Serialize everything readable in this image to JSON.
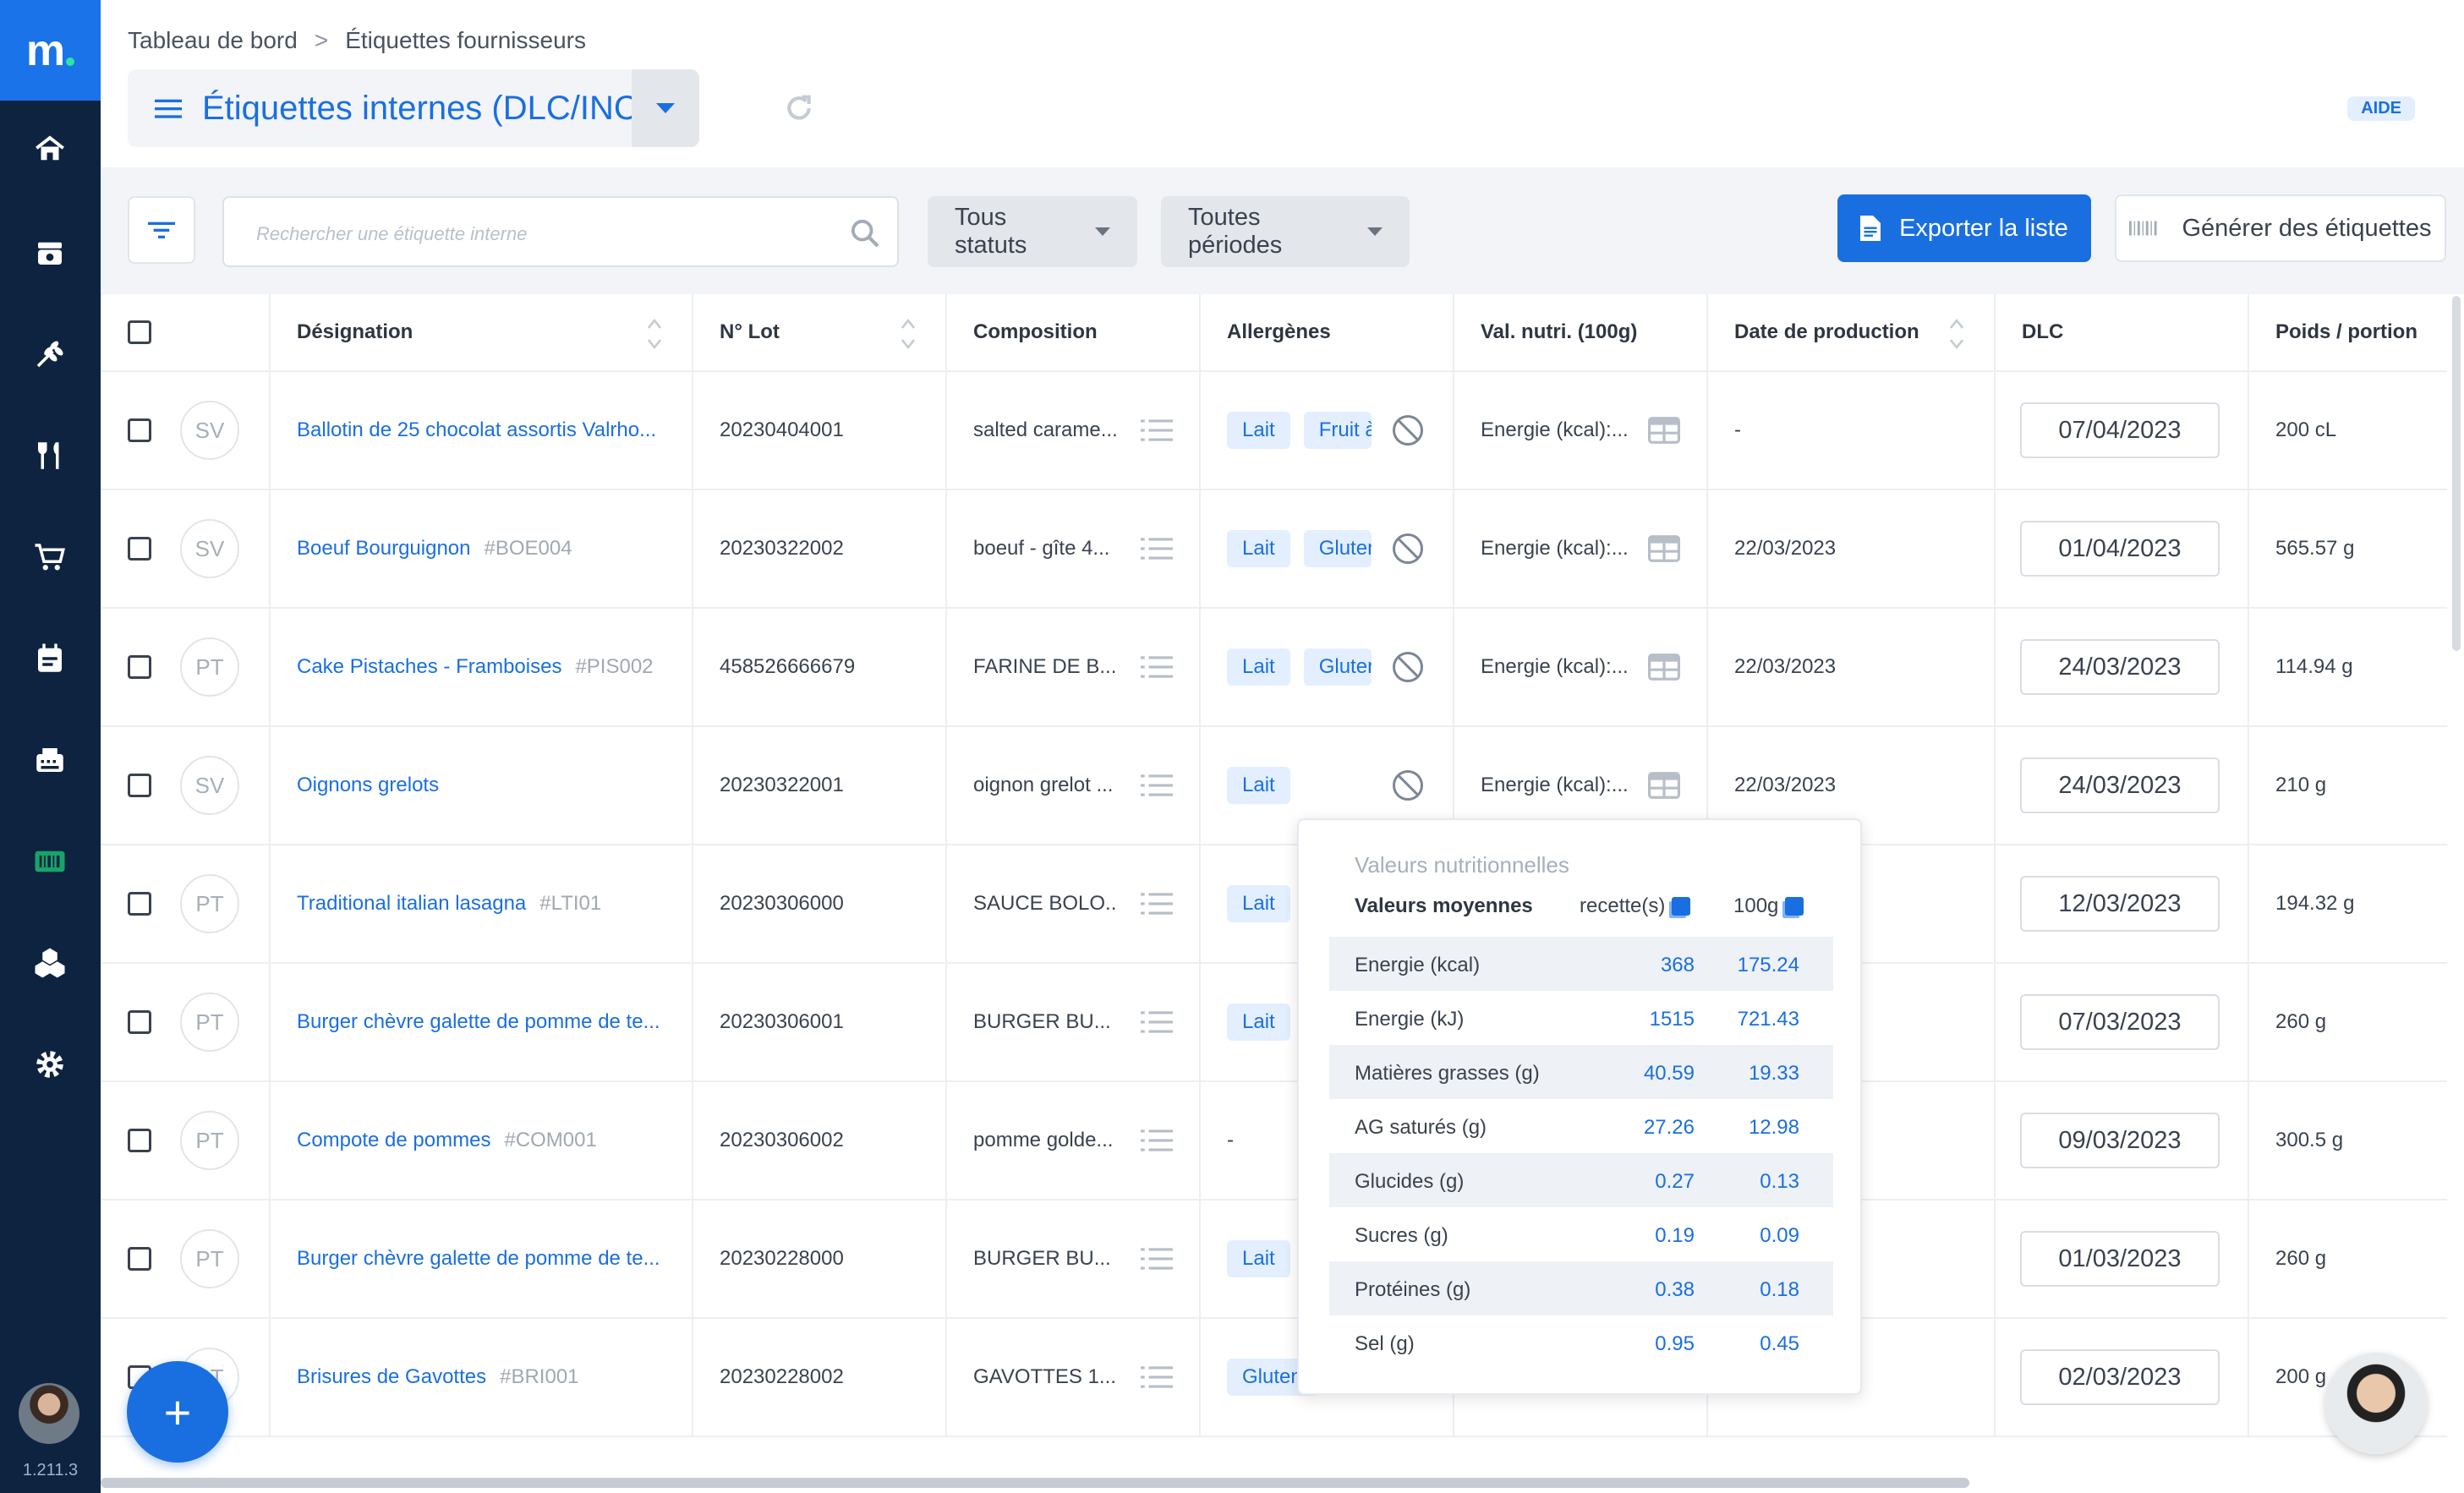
{
  "app": {
    "logo": "m",
    "version": "1.211.3"
  },
  "sidebar": {
    "items": [
      {
        "icon": "home-icon"
      },
      {
        "icon": "inbox-icon"
      },
      {
        "icon": "wheat-icon"
      },
      {
        "icon": "utensils-icon"
      },
      {
        "icon": "cart-icon"
      },
      {
        "icon": "calendar-icon"
      },
      {
        "icon": "printer-icon"
      },
      {
        "icon": "barcode-icon"
      },
      {
        "icon": "boxes-icon"
      },
      {
        "icon": "gear-icon"
      }
    ]
  },
  "breadcrumb": {
    "items": [
      "Tableau de bord",
      "Étiquettes fournisseurs"
    ],
    "separator": ">"
  },
  "header": {
    "title": "Étiquettes internes (DLC/INCO)",
    "help": "AIDE"
  },
  "toolbar": {
    "search_placeholder": "Rechercher une étiquette interne",
    "status_filter": "Tous statuts",
    "period_filter": "Toutes périodes",
    "export_label": "Exporter la liste",
    "generate_label": "Générer des étiquettes"
  },
  "table": {
    "columns": [
      "Désignation",
      "N° Lot",
      "Composition",
      "Allergènes",
      "Val. nutri. (100g)",
      "Date de production",
      "DLC",
      "Poids / portion"
    ],
    "rows": [
      {
        "initials": "SV",
        "name": "Ballotin de 25 chocolat assortis Valrho...",
        "code": "",
        "lot": "20230404001",
        "composition": "salted carame...",
        "allergens": [
          "Lait",
          "Fruit à"
        ],
        "nutri": "Energie (kcal):...",
        "production": "-",
        "dlc": "07/04/2023",
        "weight": "200 cL"
      },
      {
        "initials": "SV",
        "name": "Boeuf Bourguignon",
        "code": "#BOE004",
        "lot": "20230322002",
        "composition": "boeuf - gîte 4...",
        "allergens": [
          "Lait",
          "Gluten"
        ],
        "nutri": "Energie (kcal):...",
        "production": "22/03/2023",
        "dlc": "01/04/2023",
        "weight": "565.57 g"
      },
      {
        "initials": "PT",
        "name": "Cake Pistaches - Framboises",
        "code": "#PIS002",
        "lot": "458526666679",
        "composition": "FARINE DE B...",
        "allergens": [
          "Lait",
          "Gluten"
        ],
        "nutri": "Energie (kcal):...",
        "production": "22/03/2023",
        "dlc": "24/03/2023",
        "weight": "114.94 g"
      },
      {
        "initials": "SV",
        "name": "Oignons grelots",
        "code": "",
        "lot": "20230322001",
        "composition": "oignon grelot ...",
        "allergens": [
          "Lait"
        ],
        "nutri": "Energie (kcal):...",
        "production": "22/03/2023",
        "dlc": "24/03/2023",
        "weight": "210 g"
      },
      {
        "initials": "PT",
        "name": "Traditional italian lasagna",
        "code": "#LTI01",
        "lot": "20230306000",
        "composition": "SAUCE BOLO...",
        "allergens": [
          "Lait"
        ],
        "nutri": "",
        "production": "",
        "dlc": "12/03/2023",
        "weight": "194.32 g"
      },
      {
        "initials": "PT",
        "name": "Burger chèvre galette de pomme de te...",
        "code": "",
        "lot": "20230306001",
        "composition": "BURGER BU...",
        "allergens": [
          "Lait"
        ],
        "nutri": "",
        "production": "",
        "dlc": "07/03/2023",
        "weight": "260 g"
      },
      {
        "initials": "PT",
        "name": "Compote de pommes",
        "code": "#COM001",
        "lot": "20230306002",
        "composition": "pomme golde...",
        "allergens_text": "-",
        "allergens": [],
        "nutri": "",
        "production": "",
        "dlc": "09/03/2023",
        "weight": "300.5 g"
      },
      {
        "initials": "PT",
        "name": "Burger chèvre galette de pomme de te...",
        "code": "",
        "lot": "20230228000",
        "composition": "BURGER BU...",
        "allergens": [
          "Lait"
        ],
        "nutri": "",
        "production": "",
        "dlc": "01/03/2023",
        "weight": "260 g"
      },
      {
        "initials": "PT",
        "name": "Brisures de Gavottes",
        "code": "#BRI001",
        "lot": "20230228002",
        "composition": "GAVOTTES 1...",
        "allergens": [
          "Gluten"
        ],
        "nutri": "",
        "production": "",
        "dlc": "02/03/2023",
        "weight": "200 g"
      }
    ]
  },
  "nutrition_popup": {
    "title": "Valeurs nutritionnelles",
    "head_label": "Valeurs moyennes",
    "col_recipe": "recette(s)",
    "col_100g": "100g",
    "rows": [
      {
        "name": "Energie (kcal)",
        "recipe": "368",
        "per100": "175.24"
      },
      {
        "name": "Energie (kJ)",
        "recipe": "1515",
        "per100": "721.43"
      },
      {
        "name": "Matières grasses (g)",
        "recipe": "40.59",
        "per100": "19.33"
      },
      {
        "name": "AG saturés (g)",
        "recipe": "27.26",
        "per100": "12.98"
      },
      {
        "name": "Glucides (g)",
        "recipe": "0.27",
        "per100": "0.13"
      },
      {
        "name": "Sucres (g)",
        "recipe": "0.19",
        "per100": "0.09"
      },
      {
        "name": "Protéines (g)",
        "recipe": "0.38",
        "per100": "0.18"
      },
      {
        "name": "Sel (g)",
        "recipe": "0.95",
        "per100": "0.45"
      }
    ]
  },
  "fab": {
    "label": "+"
  },
  "colors": {
    "accent": "#1a6fe0",
    "sidebar": "#0d2340",
    "logo_bg": "#1a73e8"
  }
}
